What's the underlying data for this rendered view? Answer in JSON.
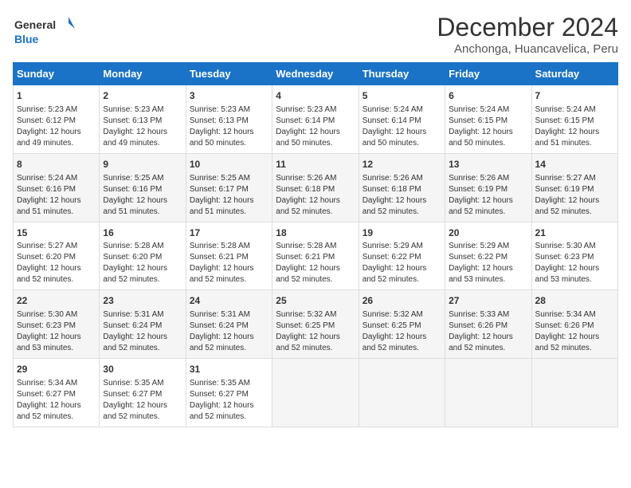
{
  "logo": {
    "line1": "General",
    "line2": "Blue"
  },
  "title": "December 2024",
  "subtitle": "Anchonga, Huancavelica, Peru",
  "headers": [
    "Sunday",
    "Monday",
    "Tuesday",
    "Wednesday",
    "Thursday",
    "Friday",
    "Saturday"
  ],
  "rows": [
    [
      {
        "day": "1",
        "text": "Sunrise: 5:23 AM\nSunset: 6:12 PM\nDaylight: 12 hours and 49 minutes."
      },
      {
        "day": "2",
        "text": "Sunrise: 5:23 AM\nSunset: 6:13 PM\nDaylight: 12 hours and 49 minutes."
      },
      {
        "day": "3",
        "text": "Sunrise: 5:23 AM\nSunset: 6:13 PM\nDaylight: 12 hours and 50 minutes."
      },
      {
        "day": "4",
        "text": "Sunrise: 5:23 AM\nSunset: 6:14 PM\nDaylight: 12 hours and 50 minutes."
      },
      {
        "day": "5",
        "text": "Sunrise: 5:24 AM\nSunset: 6:14 PM\nDaylight: 12 hours and 50 minutes."
      },
      {
        "day": "6",
        "text": "Sunrise: 5:24 AM\nSunset: 6:15 PM\nDaylight: 12 hours and 50 minutes."
      },
      {
        "day": "7",
        "text": "Sunrise: 5:24 AM\nSunset: 6:15 PM\nDaylight: 12 hours and 51 minutes."
      }
    ],
    [
      {
        "day": "8",
        "text": "Sunrise: 5:24 AM\nSunset: 6:16 PM\nDaylight: 12 hours and 51 minutes."
      },
      {
        "day": "9",
        "text": "Sunrise: 5:25 AM\nSunset: 6:16 PM\nDaylight: 12 hours and 51 minutes."
      },
      {
        "day": "10",
        "text": "Sunrise: 5:25 AM\nSunset: 6:17 PM\nDaylight: 12 hours and 51 minutes."
      },
      {
        "day": "11",
        "text": "Sunrise: 5:26 AM\nSunset: 6:18 PM\nDaylight: 12 hours and 52 minutes."
      },
      {
        "day": "12",
        "text": "Sunrise: 5:26 AM\nSunset: 6:18 PM\nDaylight: 12 hours and 52 minutes."
      },
      {
        "day": "13",
        "text": "Sunrise: 5:26 AM\nSunset: 6:19 PM\nDaylight: 12 hours and 52 minutes."
      },
      {
        "day": "14",
        "text": "Sunrise: 5:27 AM\nSunset: 6:19 PM\nDaylight: 12 hours and 52 minutes."
      }
    ],
    [
      {
        "day": "15",
        "text": "Sunrise: 5:27 AM\nSunset: 6:20 PM\nDaylight: 12 hours and 52 minutes."
      },
      {
        "day": "16",
        "text": "Sunrise: 5:28 AM\nSunset: 6:20 PM\nDaylight: 12 hours and 52 minutes."
      },
      {
        "day": "17",
        "text": "Sunrise: 5:28 AM\nSunset: 6:21 PM\nDaylight: 12 hours and 52 minutes."
      },
      {
        "day": "18",
        "text": "Sunrise: 5:28 AM\nSunset: 6:21 PM\nDaylight: 12 hours and 52 minutes."
      },
      {
        "day": "19",
        "text": "Sunrise: 5:29 AM\nSunset: 6:22 PM\nDaylight: 12 hours and 52 minutes."
      },
      {
        "day": "20",
        "text": "Sunrise: 5:29 AM\nSunset: 6:22 PM\nDaylight: 12 hours and 53 minutes."
      },
      {
        "day": "21",
        "text": "Sunrise: 5:30 AM\nSunset: 6:23 PM\nDaylight: 12 hours and 53 minutes."
      }
    ],
    [
      {
        "day": "22",
        "text": "Sunrise: 5:30 AM\nSunset: 6:23 PM\nDaylight: 12 hours and 53 minutes."
      },
      {
        "day": "23",
        "text": "Sunrise: 5:31 AM\nSunset: 6:24 PM\nDaylight: 12 hours and 52 minutes."
      },
      {
        "day": "24",
        "text": "Sunrise: 5:31 AM\nSunset: 6:24 PM\nDaylight: 12 hours and 52 minutes."
      },
      {
        "day": "25",
        "text": "Sunrise: 5:32 AM\nSunset: 6:25 PM\nDaylight: 12 hours and 52 minutes."
      },
      {
        "day": "26",
        "text": "Sunrise: 5:32 AM\nSunset: 6:25 PM\nDaylight: 12 hours and 52 minutes."
      },
      {
        "day": "27",
        "text": "Sunrise: 5:33 AM\nSunset: 6:26 PM\nDaylight: 12 hours and 52 minutes."
      },
      {
        "day": "28",
        "text": "Sunrise: 5:34 AM\nSunset: 6:26 PM\nDaylight: 12 hours and 52 minutes."
      }
    ],
    [
      {
        "day": "29",
        "text": "Sunrise: 5:34 AM\nSunset: 6:27 PM\nDaylight: 12 hours and 52 minutes."
      },
      {
        "day": "30",
        "text": "Sunrise: 5:35 AM\nSunset: 6:27 PM\nDaylight: 12 hours and 52 minutes."
      },
      {
        "day": "31",
        "text": "Sunrise: 5:35 AM\nSunset: 6:27 PM\nDaylight: 12 hours and 52 minutes."
      },
      null,
      null,
      null,
      null
    ]
  ]
}
